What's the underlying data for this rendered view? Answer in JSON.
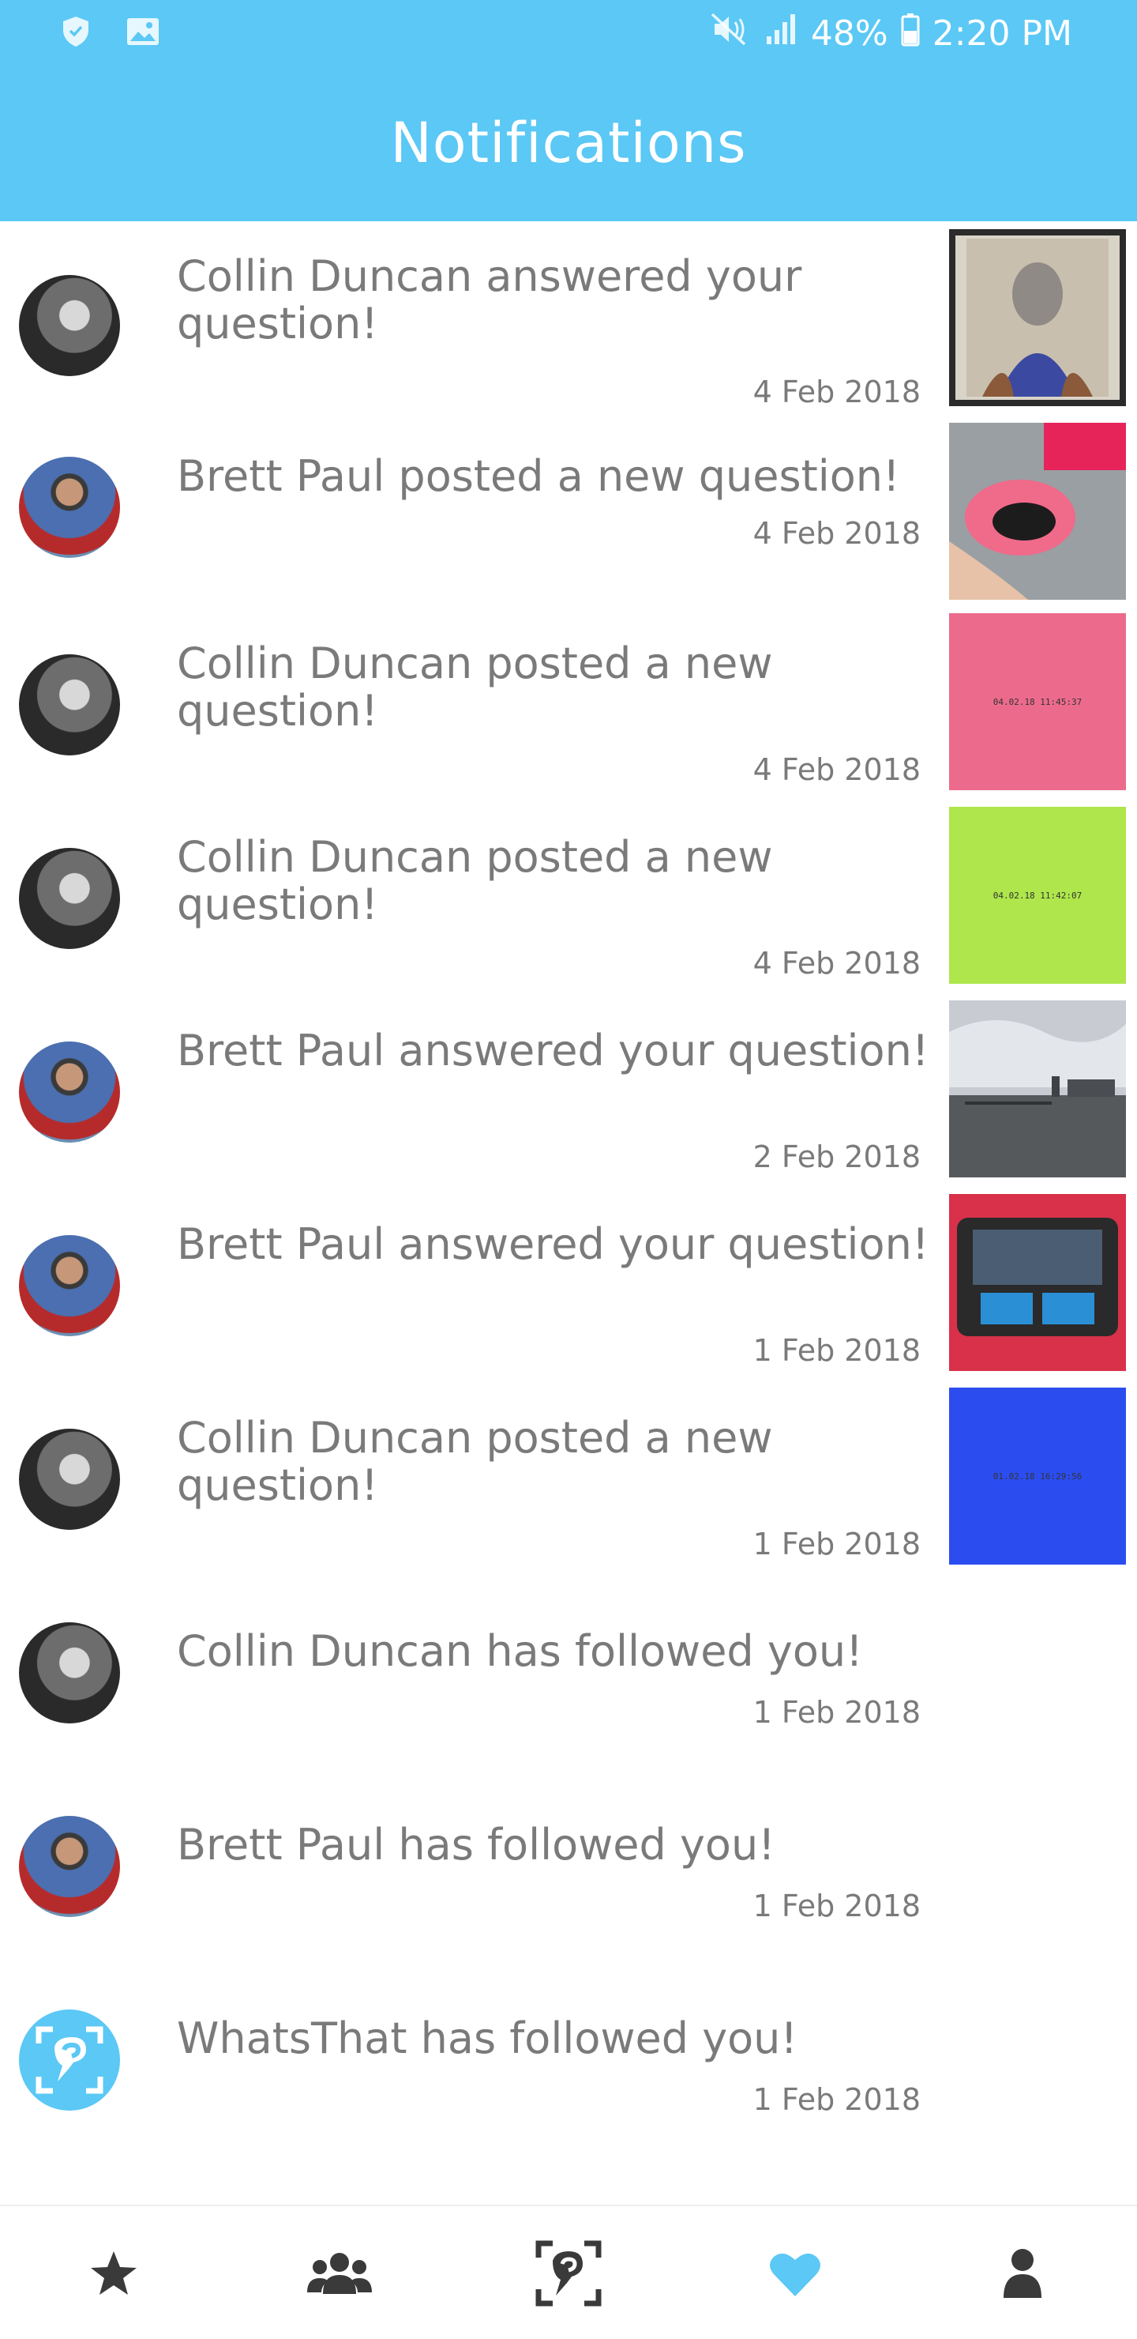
{
  "status_bar": {
    "battery": "48%",
    "time": "2:20 PM"
  },
  "header": {
    "title": "Notifications"
  },
  "notifications": [
    {
      "user": "Collin Duncan",
      "text": "Collin Duncan answered your question!",
      "date": "4 Feb 2018",
      "thumbnail": "painting-photo"
    },
    {
      "user": "Brett Paul",
      "text": "Brett Paul posted a new question!",
      "date": "4 Feb 2018",
      "thumbnail": "pink-shoe-photo"
    },
    {
      "user": "Collin Duncan",
      "text": "Collin Duncan posted a new question!",
      "date": "4 Feb 2018",
      "thumbnail": "pink-color-card",
      "thumbnail_stamp": "04.02.18 11:45:37",
      "thumbnail_color": "#ec6b8d"
    },
    {
      "user": "Collin Duncan",
      "text": "Collin Duncan posted a new question!",
      "date": "4 Feb 2018",
      "thumbnail": "green-color-card",
      "thumbnail_stamp": "04.02.18 11:42:07",
      "thumbnail_color": "#aee64b"
    },
    {
      "user": "Brett Paul",
      "text": "Brett Paul answered your question!",
      "date": "2 Feb 2018",
      "thumbnail": "harbor-photo"
    },
    {
      "user": "Brett Paul",
      "text": "Brett Paul answered your question!",
      "date": "1 Feb 2018",
      "thumbnail": "game-console-photo"
    },
    {
      "user": "Collin Duncan",
      "text": "Collin Duncan posted a new question!",
      "date": "1 Feb 2018",
      "thumbnail": "blue-color-card",
      "thumbnail_stamp": "01.02.18 16:29:56",
      "thumbnail_color": "#2b4df0"
    },
    {
      "user": "Collin Duncan",
      "text": "Collin Duncan has followed you!",
      "date": "1 Feb 2018"
    },
    {
      "user": "Brett Paul",
      "text": "Brett Paul has followed you!",
      "date": "1 Feb 2018"
    },
    {
      "user": "WhatsThat",
      "text": "WhatsThat has followed you!",
      "date": "1 Feb 2018"
    }
  ],
  "bottom_nav": {
    "items": [
      "star-icon",
      "group-icon",
      "question-camera-icon",
      "heart-icon",
      "profile-icon"
    ],
    "active": "heart-icon"
  },
  "colors": {
    "accent": "#5bc8f5",
    "text": "#7a7a7a",
    "nav_icon": "#3a3a3a"
  }
}
